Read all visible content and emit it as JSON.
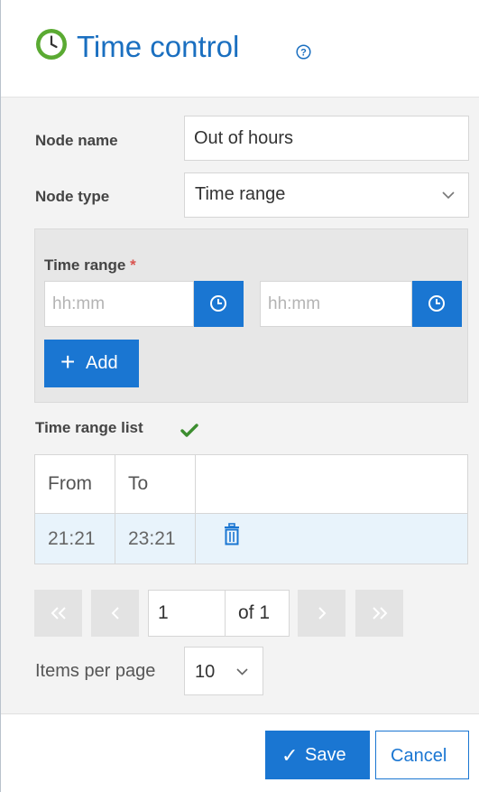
{
  "header": {
    "title": "Time control",
    "clock_icon": "clock-icon",
    "help_icon": "help-circle-icon",
    "accent_color": "#1a6fc0",
    "clock_color": "#5aaa32"
  },
  "form": {
    "node_name": {
      "label": "Node name",
      "value": "Out of hours"
    },
    "node_type": {
      "label": "Node type",
      "value": "Time range"
    }
  },
  "time_range": {
    "label": "Time range",
    "required_marker": "*",
    "start_placeholder": "hh:mm",
    "end_placeholder": "hh:mm",
    "add_label": "Add",
    "add_icon": "plus-icon"
  },
  "list": {
    "title": "Time range list",
    "status_icon": "check-icon",
    "columns": [
      "From",
      "To",
      ""
    ],
    "rows": [
      {
        "from": "21:21",
        "to": "23:21",
        "action_icon": "trash-icon"
      }
    ]
  },
  "pagination": {
    "current_page": "1",
    "of_label": "of 1",
    "first_icon": "double-chevron-left-icon",
    "prev_icon": "chevron-left-icon",
    "next_icon": "chevron-right-icon",
    "last_icon": "double-chevron-right-icon",
    "items_per_page_label": "Items per page",
    "items_per_page_value": "10"
  },
  "footer": {
    "save_label": "Save",
    "cancel_label": "Cancel"
  },
  "colors": {
    "primary": "#1a76d2",
    "body_bg": "#f3f3f3",
    "selected_row": "#e8f3fb",
    "success": "#3c8d2f",
    "required": "#d9534f"
  }
}
